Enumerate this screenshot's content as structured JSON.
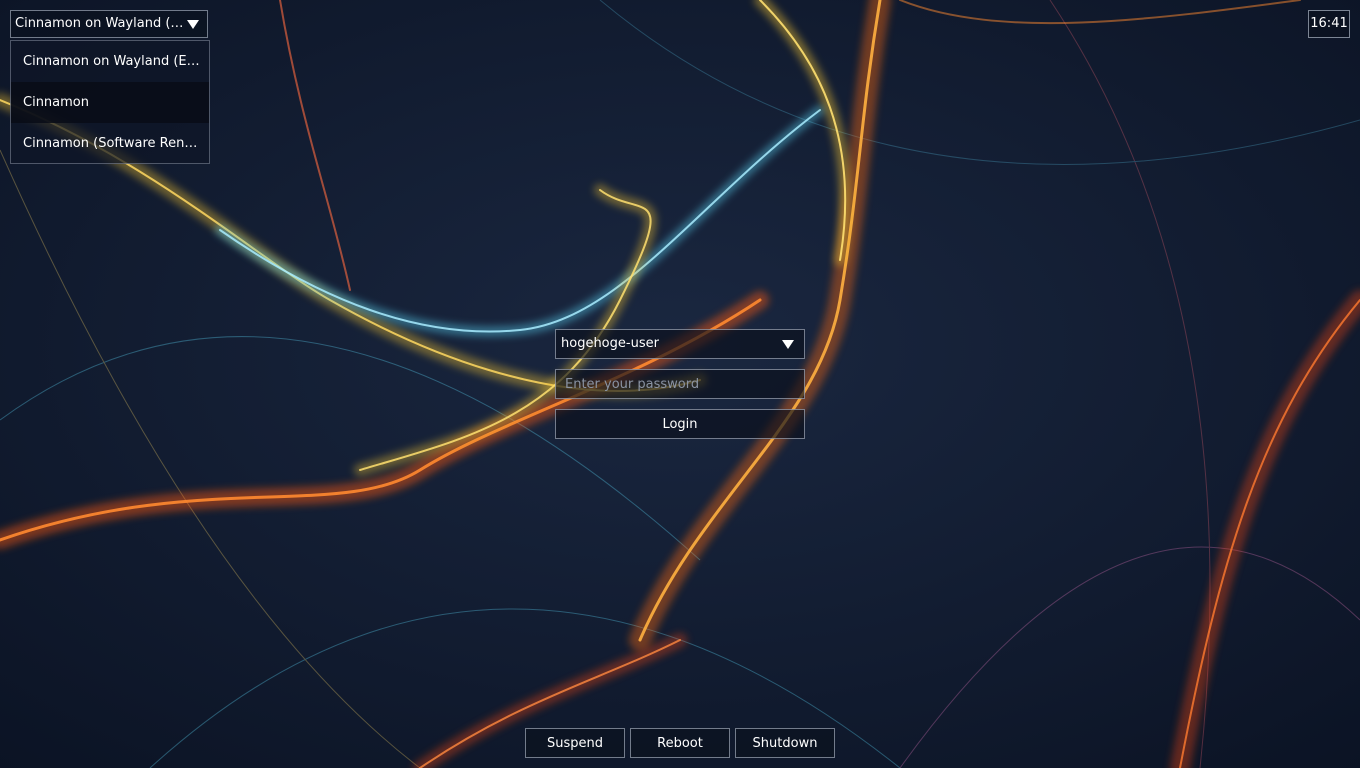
{
  "session": {
    "selected": "Cinnamon on Wayland (Experimental)",
    "options": [
      "Cinnamon on Wayland (Experimental)",
      "Cinnamon",
      "Cinnamon (Software Rendering)"
    ],
    "hovered_index": 1
  },
  "clock": {
    "time": "16:41"
  },
  "login": {
    "user": "hogehoge-user",
    "password_placeholder": "Enter your password",
    "login_label": "Login"
  },
  "power": {
    "suspend_label": "Suspend",
    "reboot_label": "Reboot",
    "shutdown_label": "Shutdown"
  },
  "colors": {
    "background": "#0f1a2e",
    "accent_orange": "#ff7a1a",
    "accent_gold": "#f2c230",
    "accent_cyan": "#5ad0f0"
  },
  "icons": {
    "dropdown": "triangle-down-icon"
  }
}
